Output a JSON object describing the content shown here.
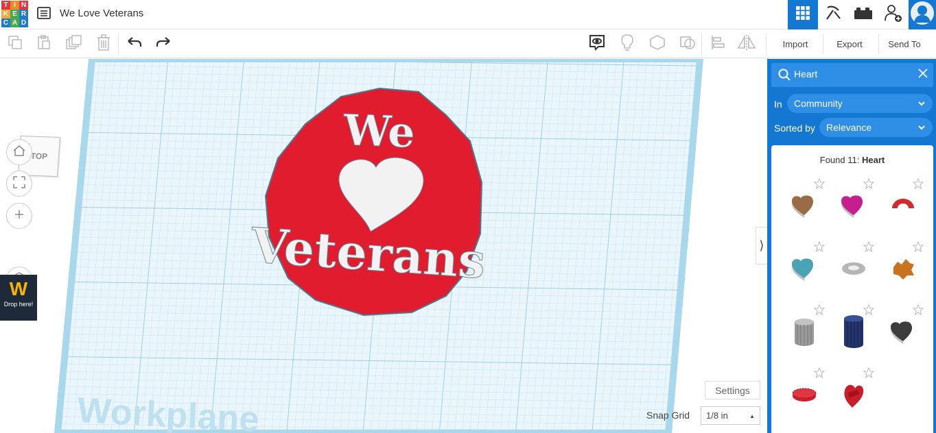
{
  "logo": {
    "letters": [
      "T",
      "I",
      "N",
      "K",
      "E",
      "R",
      "C",
      "A",
      "D"
    ],
    "colors": [
      "#e2373f",
      "#e98a2c",
      "#e2373f",
      "#f0a93a",
      "#4aa84e",
      "#1e7cc8",
      "#1e7cc8",
      "#4aa84e",
      "#1e7cc8"
    ]
  },
  "header": {
    "title": "We Love Veterans",
    "menu_icon": "list-icon",
    "right_icons": [
      "grid-view-icon",
      "pickaxe-icon",
      "brick-icon",
      "add-user-icon",
      "avatar-icon"
    ]
  },
  "toolbar": {
    "tools": [
      "copy-icon",
      "paste-icon",
      "duplicate-icon",
      "delete-icon",
      "undo-icon",
      "redo-icon"
    ],
    "view_tools": [
      "notes-icon",
      "light-bulb-icon",
      "shape-solid-icon",
      "shape-hole-icon",
      "align-icon",
      "mirror-icon"
    ],
    "import_label": "Import",
    "export_label": "Export",
    "sendto_label": "Send To"
  },
  "viewport": {
    "viewcube_label": "TOP",
    "workplane_label": "Workplane",
    "drop_label": "Drop here!",
    "drop_logo": "W",
    "model_text_top": "We",
    "model_text_bottom": "Veterans",
    "model_color": "#e01c2e",
    "settings_label": "Settings",
    "snap_grid_label": "Snap Grid",
    "snap_grid_value": "1/8 in",
    "collapse_glyph": "⟩"
  },
  "panel": {
    "search_value": "Heart",
    "in_label": "In",
    "in_value": "Community",
    "sorted_label": "Sorted by",
    "sorted_value": "Relevance",
    "found_prefix": "Found 11:",
    "found_term": "Heart",
    "items": [
      {
        "name": "brown-heart-box",
        "color": "#9a6b45"
      },
      {
        "name": "magenta-heart-box",
        "color": "#c41e8f"
      },
      {
        "name": "red-arc",
        "color": "#d12a2a"
      },
      {
        "name": "teal-heart",
        "color": "#4aa3b5"
      },
      {
        "name": "grey-ring",
        "color": "#b5b5b5"
      },
      {
        "name": "orange-gear",
        "color": "#c9731f"
      },
      {
        "name": "grey-cylinder",
        "color": "#9a9a9a"
      },
      {
        "name": "blue-cylinder",
        "color": "#24356d"
      },
      {
        "name": "dark-heart",
        "color": "#3c3c3c"
      },
      {
        "name": "red-disc",
        "color": "#c9202a"
      },
      {
        "name": "red-heart",
        "color": "#c91d2a"
      }
    ]
  },
  "colors": {
    "accent": "#1477d1",
    "accent_light": "#2f8ee6"
  }
}
